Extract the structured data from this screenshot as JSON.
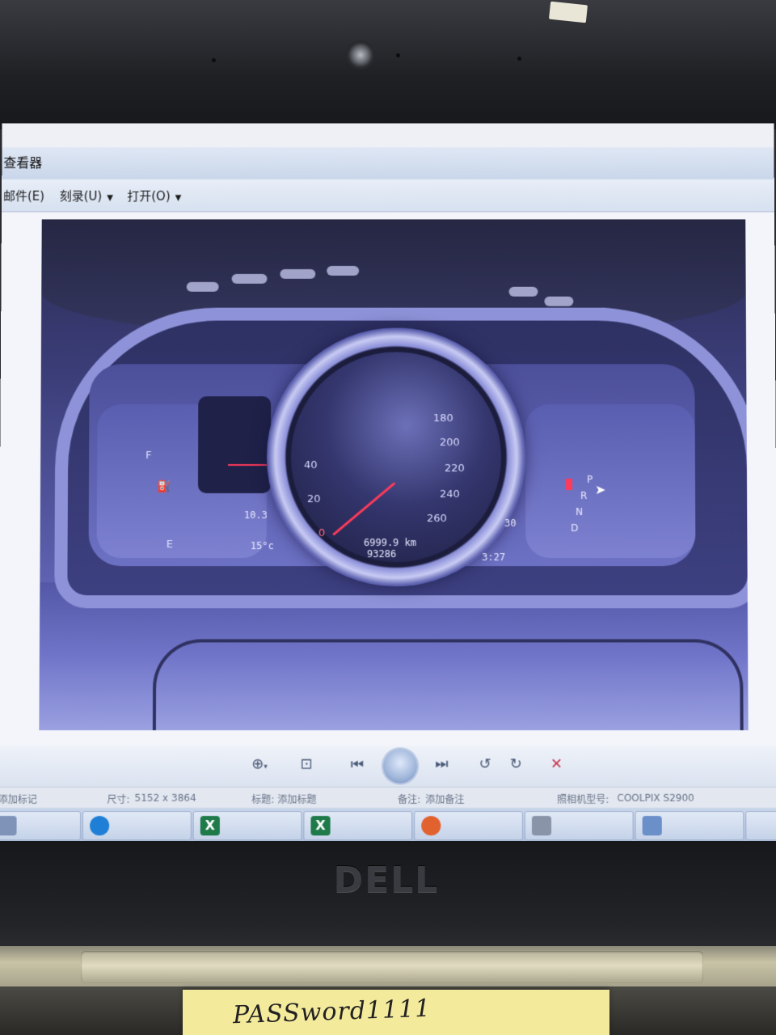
{
  "window": {
    "title": "查看器"
  },
  "menu": {
    "items": [
      {
        "label": "邮件(E)",
        "has_arrow": false
      },
      {
        "label": "刻录(U)",
        "has_arrow": true
      },
      {
        "label": "打开(O)",
        "has_arrow": true
      }
    ]
  },
  "photo": {
    "speed_ticks": [
      "0",
      "20",
      "40",
      "180",
      "200",
      "220",
      "240",
      "260"
    ],
    "odometer_trip": "6999.9 km",
    "odometer_total": "93286",
    "time": "3:27",
    "temperature": "15°c",
    "left_reading": "10.3",
    "right_number": "30",
    "fuel_full": "F",
    "fuel_empty": "E",
    "gears": [
      "P",
      "R",
      "N",
      "D"
    ]
  },
  "toolbar": {
    "zoom_icon": "zoom-icon",
    "fit_icon": "fit-icon",
    "prev_icon": "previous-icon",
    "slideshow_icon": "slideshow-icon",
    "next_icon": "next-icon",
    "rotate_ccw_icon": "rotate-counterclockwise-icon",
    "rotate_cw_icon": "rotate-clockwise-icon",
    "delete_icon": "delete-icon"
  },
  "status": {
    "tags": "添加标记",
    "dimensions_label": "尺寸:",
    "dimensions_value": "5152 x 3864",
    "title_label": "标题:",
    "title_value": "添加标题",
    "comment_label": "备注:",
    "comment_value": "添加备注",
    "camera_label": "照相机型号:",
    "camera_value": "COOLPIX S2900"
  },
  "taskbar": {
    "items": [
      {
        "icon": "folder-icon",
        "color": "#7f93b8"
      },
      {
        "icon": "edge-icon",
        "color": "#1f7fd6"
      },
      {
        "icon": "excel-icon",
        "color": "#1f7a4a",
        "glyph": "X"
      },
      {
        "icon": "excel-icon",
        "color": "#1f7a4a",
        "glyph": "X"
      },
      {
        "icon": "firefox-icon",
        "color": "#e2622f"
      },
      {
        "icon": "camera-icon",
        "color": "#8a94a8"
      },
      {
        "icon": "photo-viewer-icon",
        "color": "#6b8fc8"
      }
    ]
  },
  "sticky_note": {
    "text": "PASSword1111"
  },
  "laptop": {
    "brand": "DELL"
  }
}
